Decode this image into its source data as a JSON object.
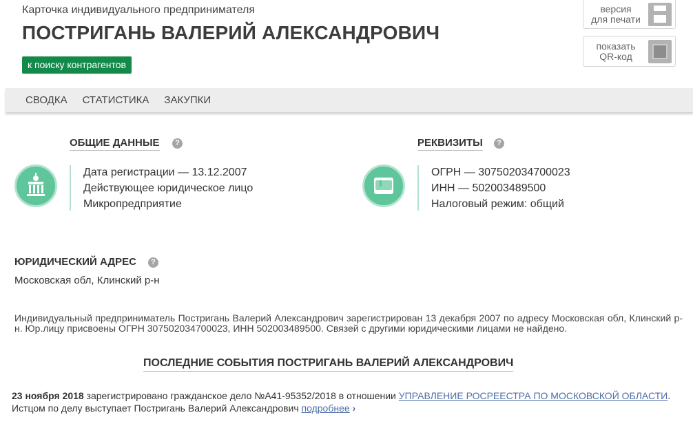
{
  "header": {
    "card_type": "Карточка индивидуального предпринимателя",
    "person_name": "ПОСТРИГАНЬ ВАЛЕРИЙ АЛЕКСАНДРОВИЧ",
    "back_link": "к поиску контрагентов",
    "print_button": [
      "версия",
      "для печати"
    ],
    "qr_button": [
      "показать",
      "QR-код"
    ]
  },
  "tabs": [
    "СВОДКА",
    "СТАТИСТИКА",
    "ЗАКУПКИ"
  ],
  "general": {
    "title": "ОБЩИЕ ДАННЫЕ",
    "help": "?",
    "lines": [
      "Дата регистрации — 13.12.2007",
      "Действующее юридическое лицо",
      "Микропредприятие"
    ]
  },
  "requisites": {
    "title": "РЕКВИЗИТЫ",
    "help": "?",
    "lines": [
      "ОГРН — 307502034700023",
      "ИНН — 502003489500",
      "Налоговый режим: общий"
    ]
  },
  "address": {
    "title": "ЮРИДИЧЕСКИЙ АДРЕС",
    "help": "?",
    "value": "Московская обл, Клинский р-н"
  },
  "summary": "Индивидуальный предприниматель Постригань Валерий Александрович зарегистрирован 13 декабря 2007 по адресу Московская обл, Клинский р-н. Юр.лицу присвоены ОГРН 307502034700023, ИНН 502003489500. Связей с другими юридическими лицами не найдено.",
  "events": {
    "title": "ПОСЛЕДНИЕ СОБЫТИЯ ПОСТРИГАНЬ ВАЛЕРИЙ АЛЕКСАНДРОВИЧ",
    "item": {
      "date": "23 ноября 2018",
      "text1": " зарегистрировано гражданское дело №А41-95352/2018 в отношении ",
      "link": "УПРАВЛЕНИЕ РОСРЕЕСТРА ПО МОСКОВСКОЙ ОБЛАСТИ",
      "text2": ". Истцом по делу выступает Постригань Валерий Александрович ",
      "more": "подробнее",
      "arrow": "›"
    }
  },
  "colors": {
    "brand_green": "#138a4a",
    "icon_green": "#5fc59a",
    "link_blue": "#4e6ea8"
  },
  "icons": {
    "print": "printer-icon",
    "qr": "qr-code-icon",
    "general": "government-building-icon",
    "requisites": "document-folder-icon",
    "help": "question-circle-icon"
  }
}
